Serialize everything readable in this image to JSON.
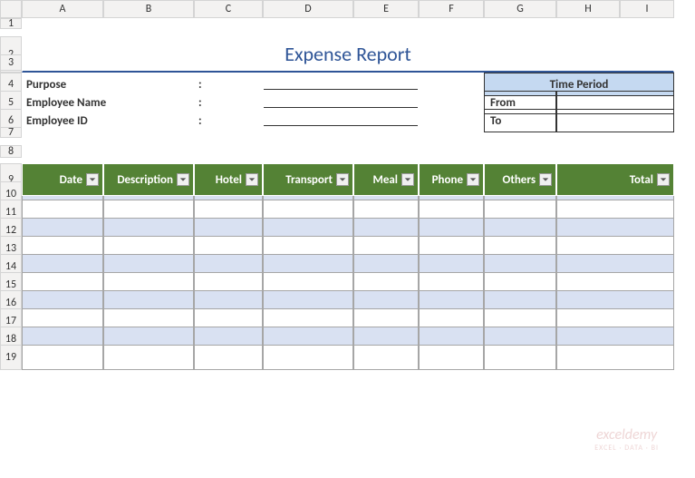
{
  "columns": [
    "A",
    "B",
    "C",
    "D",
    "E",
    "F",
    "G",
    "H",
    "I"
  ],
  "rows": [
    "1",
    "2",
    "3",
    "4",
    "5",
    "6",
    "7",
    "8",
    "9",
    "10",
    "11",
    "12",
    "13",
    "14",
    "15",
    "16",
    "17",
    "18",
    "19"
  ],
  "title": "Expense Report",
  "form": {
    "purpose_label": "Purpose",
    "employee_name_label": "Employee Name",
    "employee_id_label": "Employee ID",
    "colon": ":"
  },
  "time_period": {
    "header": "Time Period",
    "from_label": "From",
    "to_label": "To",
    "from_value": "",
    "to_value": ""
  },
  "table": {
    "headers": [
      "Date",
      "Description",
      "Hotel",
      "Transport",
      "Meal",
      "Phone",
      "Others",
      "Total"
    ]
  },
  "watermark": {
    "main": "exceldemy",
    "sub": "EXCEL · DATA · BI"
  }
}
